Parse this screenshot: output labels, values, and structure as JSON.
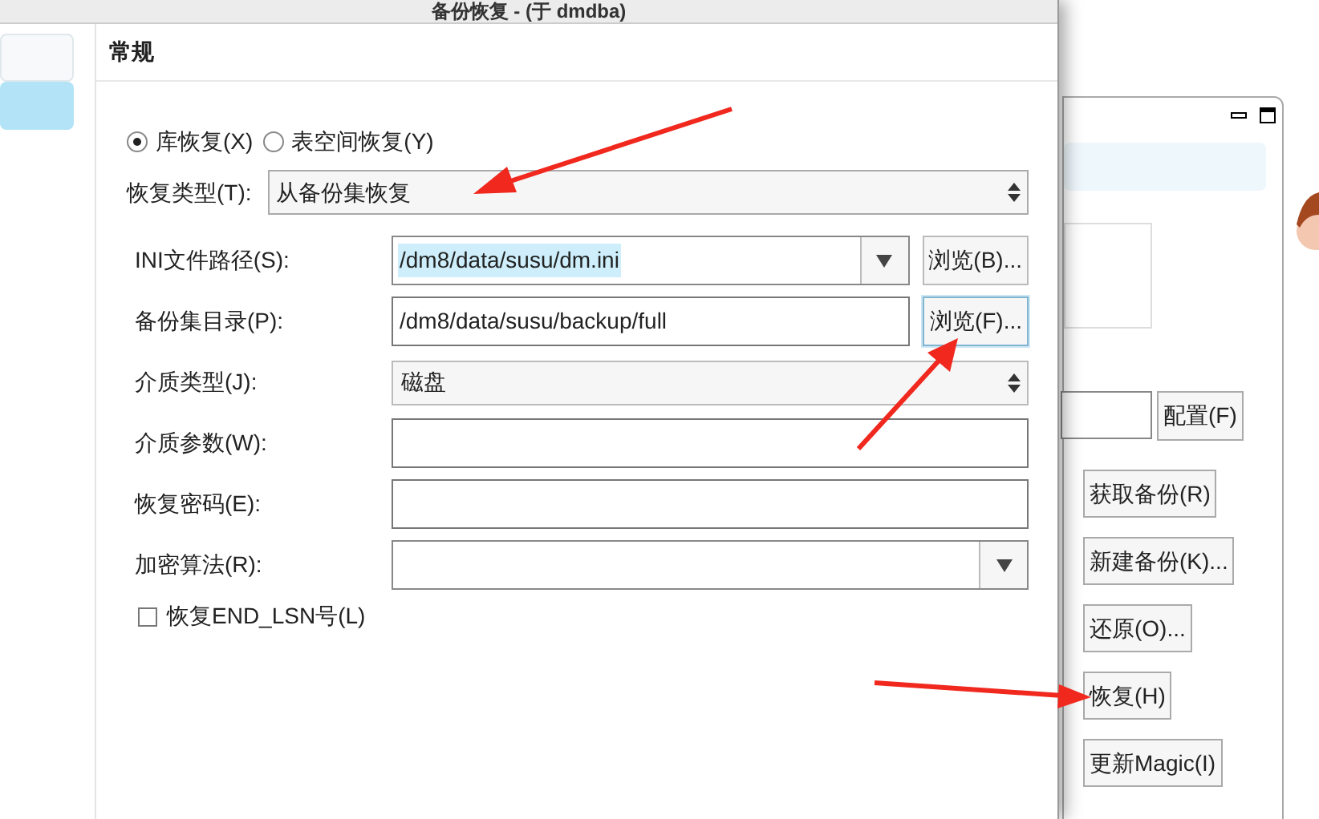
{
  "window": {
    "title": "备份恢复 - (于 dmdba)"
  },
  "sidebar": {
    "items": [
      {
        "selected": false
      },
      {
        "selected": true
      }
    ]
  },
  "section": "常规",
  "restore_scope": [
    {
      "label": "库恢复(X)",
      "selected": true
    },
    {
      "label": "表空间恢复(Y)",
      "selected": false
    }
  ],
  "restore_type": {
    "label": "恢复类型(T):",
    "value": "从备份集恢复"
  },
  "fields": [
    {
      "kind": "combo",
      "label": "INI文件路径(S):",
      "value": "/dm8/data/susu/dm.ini",
      "text_selected": true,
      "button": {
        "label": "浏览(B)...",
        "focused": false
      }
    },
    {
      "kind": "text",
      "label": "备份集目录(P):",
      "value": "/dm8/data/susu/backup/full",
      "text_selected": false,
      "button": {
        "label": "浏览(F)...",
        "focused": true
      }
    },
    {
      "kind": "select",
      "label": "介质类型(J):",
      "value": "磁盘",
      "text_selected": false
    },
    {
      "kind": "text",
      "label": "介质参数(W):"
    },
    {
      "kind": "text",
      "label": "恢复密码(E):"
    },
    {
      "kind": "combo",
      "label": "加密算法(R):"
    }
  ],
  "end_lsn": {
    "label": "恢复END_LSN号(L)",
    "checked": false
  },
  "background_window": {
    "config_button": "配置(F)",
    "buttons": [
      "获取备份(R)",
      "新建备份(K)...",
      "还原(O)...",
      "恢复(H)",
      "更新Magic(I)"
    ]
  }
}
